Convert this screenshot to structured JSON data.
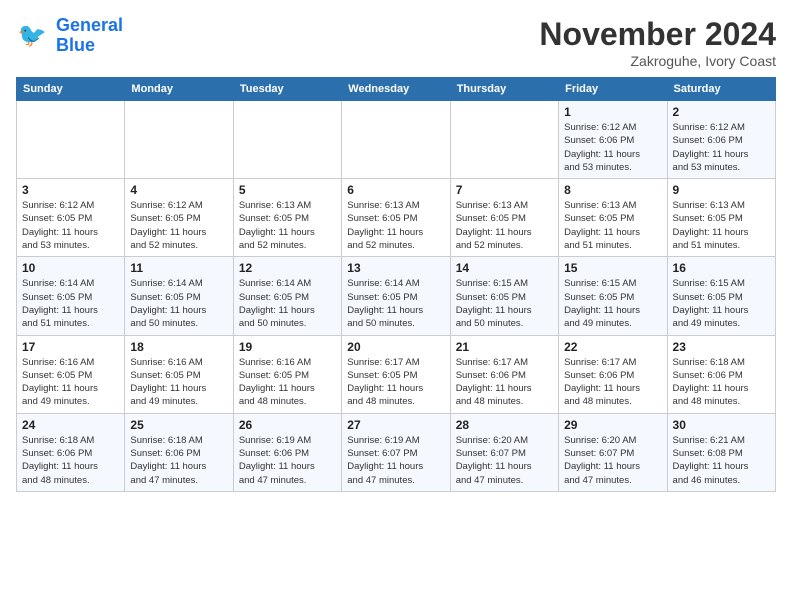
{
  "header": {
    "logo_line1": "General",
    "logo_line2": "Blue",
    "month": "November 2024",
    "location": "Zakroguhe, Ivory Coast"
  },
  "weekdays": [
    "Sunday",
    "Monday",
    "Tuesday",
    "Wednesday",
    "Thursday",
    "Friday",
    "Saturday"
  ],
  "weeks": [
    [
      {
        "day": "",
        "info": ""
      },
      {
        "day": "",
        "info": ""
      },
      {
        "day": "",
        "info": ""
      },
      {
        "day": "",
        "info": ""
      },
      {
        "day": "",
        "info": ""
      },
      {
        "day": "1",
        "info": "Sunrise: 6:12 AM\nSunset: 6:06 PM\nDaylight: 11 hours\nand 53 minutes."
      },
      {
        "day": "2",
        "info": "Sunrise: 6:12 AM\nSunset: 6:06 PM\nDaylight: 11 hours\nand 53 minutes."
      }
    ],
    [
      {
        "day": "3",
        "info": "Sunrise: 6:12 AM\nSunset: 6:05 PM\nDaylight: 11 hours\nand 53 minutes."
      },
      {
        "day": "4",
        "info": "Sunrise: 6:12 AM\nSunset: 6:05 PM\nDaylight: 11 hours\nand 52 minutes."
      },
      {
        "day": "5",
        "info": "Sunrise: 6:13 AM\nSunset: 6:05 PM\nDaylight: 11 hours\nand 52 minutes."
      },
      {
        "day": "6",
        "info": "Sunrise: 6:13 AM\nSunset: 6:05 PM\nDaylight: 11 hours\nand 52 minutes."
      },
      {
        "day": "7",
        "info": "Sunrise: 6:13 AM\nSunset: 6:05 PM\nDaylight: 11 hours\nand 52 minutes."
      },
      {
        "day": "8",
        "info": "Sunrise: 6:13 AM\nSunset: 6:05 PM\nDaylight: 11 hours\nand 51 minutes."
      },
      {
        "day": "9",
        "info": "Sunrise: 6:13 AM\nSunset: 6:05 PM\nDaylight: 11 hours\nand 51 minutes."
      }
    ],
    [
      {
        "day": "10",
        "info": "Sunrise: 6:14 AM\nSunset: 6:05 PM\nDaylight: 11 hours\nand 51 minutes."
      },
      {
        "day": "11",
        "info": "Sunrise: 6:14 AM\nSunset: 6:05 PM\nDaylight: 11 hours\nand 50 minutes."
      },
      {
        "day": "12",
        "info": "Sunrise: 6:14 AM\nSunset: 6:05 PM\nDaylight: 11 hours\nand 50 minutes."
      },
      {
        "day": "13",
        "info": "Sunrise: 6:14 AM\nSunset: 6:05 PM\nDaylight: 11 hours\nand 50 minutes."
      },
      {
        "day": "14",
        "info": "Sunrise: 6:15 AM\nSunset: 6:05 PM\nDaylight: 11 hours\nand 50 minutes."
      },
      {
        "day": "15",
        "info": "Sunrise: 6:15 AM\nSunset: 6:05 PM\nDaylight: 11 hours\nand 49 minutes."
      },
      {
        "day": "16",
        "info": "Sunrise: 6:15 AM\nSunset: 6:05 PM\nDaylight: 11 hours\nand 49 minutes."
      }
    ],
    [
      {
        "day": "17",
        "info": "Sunrise: 6:16 AM\nSunset: 6:05 PM\nDaylight: 11 hours\nand 49 minutes."
      },
      {
        "day": "18",
        "info": "Sunrise: 6:16 AM\nSunset: 6:05 PM\nDaylight: 11 hours\nand 49 minutes."
      },
      {
        "day": "19",
        "info": "Sunrise: 6:16 AM\nSunset: 6:05 PM\nDaylight: 11 hours\nand 48 minutes."
      },
      {
        "day": "20",
        "info": "Sunrise: 6:17 AM\nSunset: 6:05 PM\nDaylight: 11 hours\nand 48 minutes."
      },
      {
        "day": "21",
        "info": "Sunrise: 6:17 AM\nSunset: 6:06 PM\nDaylight: 11 hours\nand 48 minutes."
      },
      {
        "day": "22",
        "info": "Sunrise: 6:17 AM\nSunset: 6:06 PM\nDaylight: 11 hours\nand 48 minutes."
      },
      {
        "day": "23",
        "info": "Sunrise: 6:18 AM\nSunset: 6:06 PM\nDaylight: 11 hours\nand 48 minutes."
      }
    ],
    [
      {
        "day": "24",
        "info": "Sunrise: 6:18 AM\nSunset: 6:06 PM\nDaylight: 11 hours\nand 48 minutes."
      },
      {
        "day": "25",
        "info": "Sunrise: 6:18 AM\nSunset: 6:06 PM\nDaylight: 11 hours\nand 47 minutes."
      },
      {
        "day": "26",
        "info": "Sunrise: 6:19 AM\nSunset: 6:06 PM\nDaylight: 11 hours\nand 47 minutes."
      },
      {
        "day": "27",
        "info": "Sunrise: 6:19 AM\nSunset: 6:07 PM\nDaylight: 11 hours\nand 47 minutes."
      },
      {
        "day": "28",
        "info": "Sunrise: 6:20 AM\nSunset: 6:07 PM\nDaylight: 11 hours\nand 47 minutes."
      },
      {
        "day": "29",
        "info": "Sunrise: 6:20 AM\nSunset: 6:07 PM\nDaylight: 11 hours\nand 47 minutes."
      },
      {
        "day": "30",
        "info": "Sunrise: 6:21 AM\nSunset: 6:08 PM\nDaylight: 11 hours\nand 46 minutes."
      }
    ]
  ]
}
